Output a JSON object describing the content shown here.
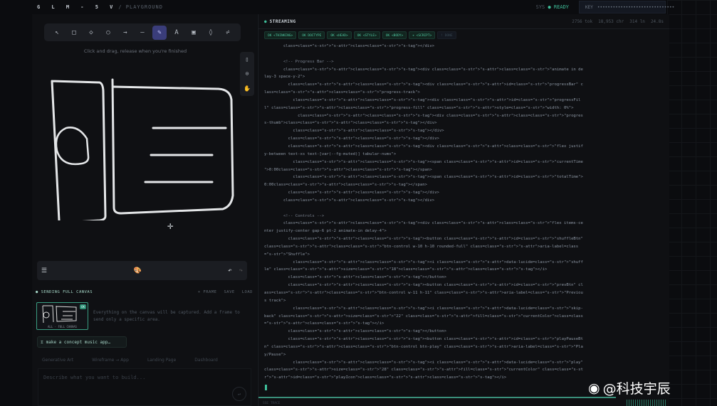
{
  "header": {
    "brand": "G L M - 5 V",
    "crumb": "/ PLAYGROUND",
    "sys_label": "SYS",
    "status": "READY",
    "key_label": "KEY",
    "key_value": "••••••••••••••••••••••••••••••"
  },
  "canvas": {
    "tools": [
      {
        "icon": "pointer-icon",
        "glyph": "↖"
      },
      {
        "icon": "rectangle-icon",
        "glyph": "□"
      },
      {
        "icon": "diamond-icon",
        "glyph": "◇"
      },
      {
        "icon": "ellipse-icon",
        "glyph": "○"
      },
      {
        "icon": "arrow-icon",
        "glyph": "→"
      },
      {
        "icon": "line-icon",
        "glyph": "—"
      },
      {
        "icon": "pencil-icon",
        "glyph": "✎",
        "active": true
      },
      {
        "icon": "text-icon",
        "glyph": "A"
      },
      {
        "icon": "image-icon",
        "glyph": "▣"
      },
      {
        "icon": "eraser-icon",
        "glyph": "◊"
      },
      {
        "icon": "more-tools-icon",
        "glyph": "⩫"
      }
    ],
    "hint": "Click and drag, release when you're finished",
    "side_tools": [
      {
        "icon": "library-icon",
        "glyph": "▯"
      },
      {
        "icon": "lock-icon",
        "glyph": "⊙"
      },
      {
        "icon": "hand-icon",
        "glyph": "✋"
      }
    ],
    "bottom": {
      "menu_icon": "☰",
      "palette_icon": "🎨",
      "undo_icon": "↶",
      "redo_icon": "↷"
    }
  },
  "sending": {
    "title": "SENDING FULL CANVAS",
    "actions": [
      "+ FRAME",
      "SAVE",
      "LOAD"
    ],
    "thumb_caption": "ALL · FULL CANVAS",
    "thumb_badge": "OK",
    "description": "Everything on the canvas will be captured. Add a frame to send only a specific area."
  },
  "chip": "make a concept music app…",
  "examples": [
    "Generative Art",
    "Wireframe → App",
    "Landing Page",
    "Dashboard"
  ],
  "prompt": {
    "placeholder": "Describe what you want to build..."
  },
  "stream": {
    "title": "STREAMING",
    "stats": [
      "2756 tok",
      "18,953 chr",
      "314 ln",
      "24.8s"
    ],
    "tags": [
      {
        "label": "OK <THINKING>",
        "done": true
      },
      {
        "label": "OK DOCTYPE",
        "done": true
      },
      {
        "label": "OK <HEAD>",
        "done": true
      },
      {
        "label": "OK <STYLE>",
        "done": true
      },
      {
        "label": "OK <BODY>",
        "done": true
      },
      {
        "label": "+ <SCRIPT>",
        "done": true
      },
      {
        "label": "! DONE",
        "done": false
      }
    ],
    "code": [
      "        class=class=\"s-str\">\"s-attr\">class=class=\"s-str\">\"s-tag\"></div>",
      "",
      "        <!-- Progress Bar -->",
      "        class=class=\"s-str\">\"s-attr\">class=class=\"s-str\">\"s-tag\"><div class=class=\"s-str\">\"s-attr\">class=class=\"s-str\">\"animate in de",
      "lay-3 space-y-2\">",
      "          class=class=\"s-str\">\"s-attr\">class=class=\"s-str\">\"s-tag\"><div class=class=\"s-str\">\"s-attr\">id=class=\"s-str\">\"progressBar\" c",
      "lass=class=\"s-str\">\"s-attr\">class=class=\"s-str\">\"progress-track\">",
      "            class=class=\"s-str\">\"s-attr\">class=class=\"s-str\">\"s-tag\"><div class=class=\"s-str\">\"s-attr\">id=class=\"s-str\">\"progressFil",
      "l\" class=class=\"s-str\">\"s-attr\">class=class=\"s-str\">\"progress-fill\" class=class=\"s-str\">\"s-attr\">style=class=\"s-str\">\"width: 0%\">",
      "              class=class=\"s-str\">\"s-attr\">class=class=\"s-str\">\"s-tag\"><div class=class=\"s-str\">\"s-attr\">class=class=\"s-str\">\"progres",
      "s-thumb\">class=class=\"s-str\">\"s-attr\">class=class=\"s-str\">\"s-tag\"></div>",
      "            class=class=\"s-str\">\"s-attr\">class=class=\"s-str\">\"s-tag\"></div>",
      "          class=class=\"s-str\">\"s-attr\">class=class=\"s-str\">\"s-tag\"></div>",
      "          class=class=\"s-str\">\"s-attr\">class=class=\"s-str\">\"s-tag\"><div class=class=\"s-str\">\"s-attr\">class=class=\"s-str\">\"flex justif",
      "y-between text-xs text-[var(--fg-muted)] tabular-nums\">",
      "            class=class=\"s-str\">\"s-attr\">class=class=\"s-str\">\"s-tag\"><span class=class=\"s-str\">\"s-attr\">id=class=\"s-str\">\"currentTime",
      "\">0:00class=class=\"s-str\">\"s-attr\">class=class=\"s-str\">\"s-tag\"></span>",
      "            class=class=\"s-str\">\"s-attr\">class=class=\"s-str\">\"s-tag\"><span class=class=\"s-str\">\"s-attr\">id=class=\"s-str\">\"totalTime\">",
      "0:00class=class=\"s-str\">\"s-attr\">class=class=\"s-str\">\"s-tag\"></span>",
      "          class=class=\"s-str\">\"s-attr\">class=class=\"s-str\">\"s-tag\"></div>",
      "        class=class=\"s-str\">\"s-attr\">class=class=\"s-str\">\"s-tag\"></div>",
      "",
      "        <!-- Controls -->",
      "        class=class=\"s-str\">\"s-attr\">class=class=\"s-str\">\"s-tag\"><div class=class=\"s-str\">\"s-attr\">class=class=\"s-str\">\"flex items-ce",
      "nter justify-center gap-6 pt-2 animate-in delay-4\">",
      "          class=class=\"s-str\">\"s-attr\">class=class=\"s-str\">\"s-tag\"><button class=class=\"s-str\">\"s-attr\">id=class=\"s-str\">\"shuffleBtn\"",
      "class=class=\"s-str\">\"s-attr\">class=class=\"s-str\">\"btn-control w-10 h-10 rounded-full\" class=class=\"s-str\">\"s-attr\">aria-label=class",
      "=\"s-str\">\"Shuffle\">",
      "            class=class=\"s-str\">\"s-attr\">class=class=\"s-str\">\"s-tag\"><i class=class=\"s-str\">\"s-attr\">data-lucide=class=\"s-str\">\"shuff",
      "le\" class=class=\"s-str\">\"s-attr\">size=class=\"s-str\">\"18\">class=class=\"s-str\">\"s-attr\">class=class=\"s-str\">\"s-tag\"></i>",
      "          class=class=\"s-str\">\"s-attr\">class=class=\"s-str\">\"s-tag\"></button>",
      "          class=class=\"s-str\">\"s-attr\">class=class=\"s-str\">\"s-tag\"><button class=class=\"s-str\">\"s-attr\">id=class=\"s-str\">\"prevBtn\" cl",
      "ass=class=\"s-str\">\"s-attr\">class=class=\"s-str\">\"btn-control w-11 h-11\" class=class=\"s-str\">\"s-attr\">aria-label=class=\"s-str\">\"Previou",
      "s track\">",
      "            class=class=\"s-str\">\"s-attr\">class=class=\"s-str\">\"s-tag\"><i class=class=\"s-str\">\"s-attr\">data-lucide=class=\"s-str\">\"skip-",
      "back\" class=class=\"s-str\">\"s-attr\">size=class=\"s-str\">\"22\" class=class=\"s-str\">\"s-attr\">fill=class=\"s-str\">\"currentColor\">class=class",
      "=\"s-str\">\"s-attr\">class=class=\"s-str\">\"s-tag\"></i>",
      "          class=class=\"s-str\">\"s-attr\">class=class=\"s-str\">\"s-tag\"></button>",
      "          class=class=\"s-str\">\"s-attr\">class=class=\"s-str\">\"s-tag\"><button class=class=\"s-str\">\"s-attr\">id=class=\"s-str\">\"playPauseBt",
      "n\" class=class=\"s-str\">\"s-attr\">class=class=\"s-str\">\"btn-control btn-play\" class=class=\"s-str\">\"s-attr\">aria-label=class=\"s-str\">\"Pla",
      "y/Pause\">",
      "            class=class=\"s-str\">\"s-attr\">class=class=\"s-str\">\"s-tag\"><i class=class=\"s-str\">\"s-attr\">data-lucide=class=\"s-str\">\"play\"",
      "class=class=\"s-str\">\"s-attr\">size=class=\"s-str\">\"28\" class=class=\"s-str\">\"s-attr\">fill=class=\"s-str\">\"currentColor\" class=class=\"s-st",
      "r\">\"s-attr\">id=class=\"s-str\">\"playIcon\">class=class=\"s-str\">\"s-attr\">class=class=\"s-str\">\"s-tag\"></i>"
    ],
    "footer": "SSE TRACE"
  },
  "watermark": "@科技宇辰",
  "colors": {
    "accent": "#3fbf9a",
    "active_tool": "#3a3d7a",
    "background": "#0b0c0f"
  }
}
